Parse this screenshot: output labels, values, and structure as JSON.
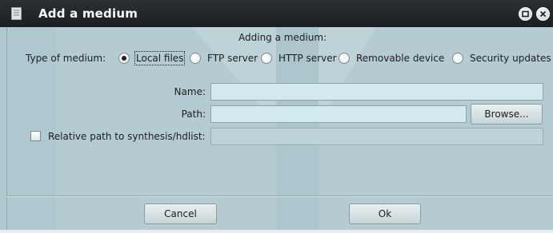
{
  "window": {
    "title": "Add a medium",
    "controls": [
      "maximize-icon",
      "close-icon"
    ]
  },
  "heading": "Adding a medium:",
  "medium_type": {
    "label": "Type of medium:",
    "options": [
      {
        "label": "Local files",
        "selected": true
      },
      {
        "label": "FTP server",
        "selected": false
      },
      {
        "label": "HTTP server",
        "selected": false
      },
      {
        "label": "Removable device",
        "selected": false
      },
      {
        "label": "Security updates",
        "selected": false
      }
    ]
  },
  "fields": {
    "name": {
      "label": "Name:",
      "value": ""
    },
    "path": {
      "label": "Path:",
      "value": ""
    },
    "browse_label": "Browse...",
    "relative_path": {
      "label": "Relative path to synthesis/hdlist:",
      "checked": false,
      "value": ""
    }
  },
  "buttons": {
    "cancel": "Cancel",
    "ok": "Ok"
  },
  "colors": {
    "background": "#b3cbd1",
    "titlebar": "#1f2426",
    "input": "#d2e9ef",
    "accent_shape": "#a2bec5"
  }
}
